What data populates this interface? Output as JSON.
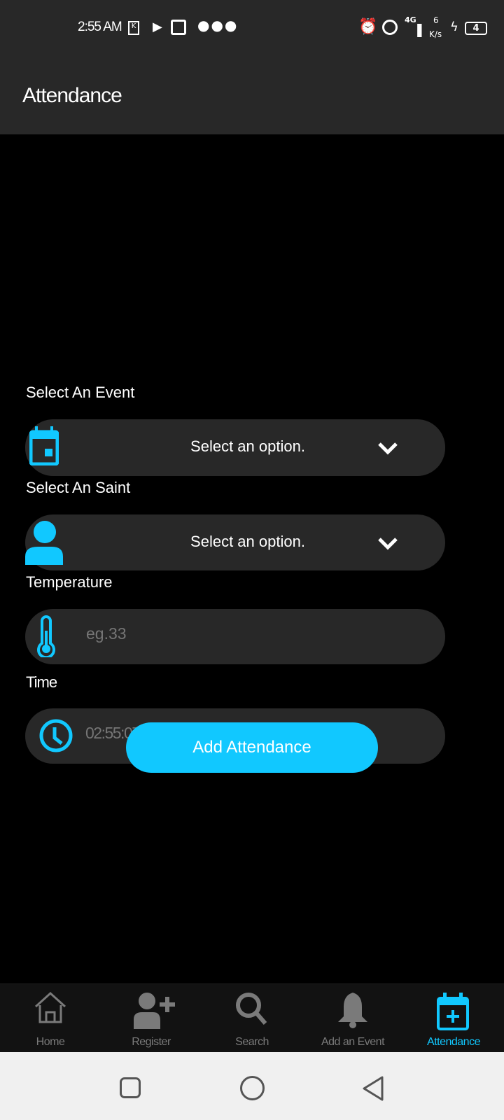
{
  "status_bar": {
    "time": "2:55 AM",
    "network": "4G",
    "speed_value": "6",
    "speed_unit": "K/s",
    "battery": "4"
  },
  "header": {
    "title": "Attendance"
  },
  "form": {
    "event": {
      "label": "Select An Event",
      "value": "Select an option."
    },
    "saint": {
      "label": "Select An Saint",
      "value": "Select an option."
    },
    "temperature": {
      "label": "Temperature",
      "placeholder": "eg.33"
    },
    "time": {
      "label": "Time",
      "placeholder": "02:55:07"
    },
    "submit_label": "Add Attendance"
  },
  "bottom_nav": {
    "items": [
      {
        "label": "Home"
      },
      {
        "label": "Register"
      },
      {
        "label": "Search"
      },
      {
        "label": "Add an Event"
      },
      {
        "label": "Attendance"
      }
    ],
    "active": 4
  },
  "colors": {
    "accent": "#11c8ff",
    "inactive": "#7a7a7a",
    "surface": "#282828"
  }
}
